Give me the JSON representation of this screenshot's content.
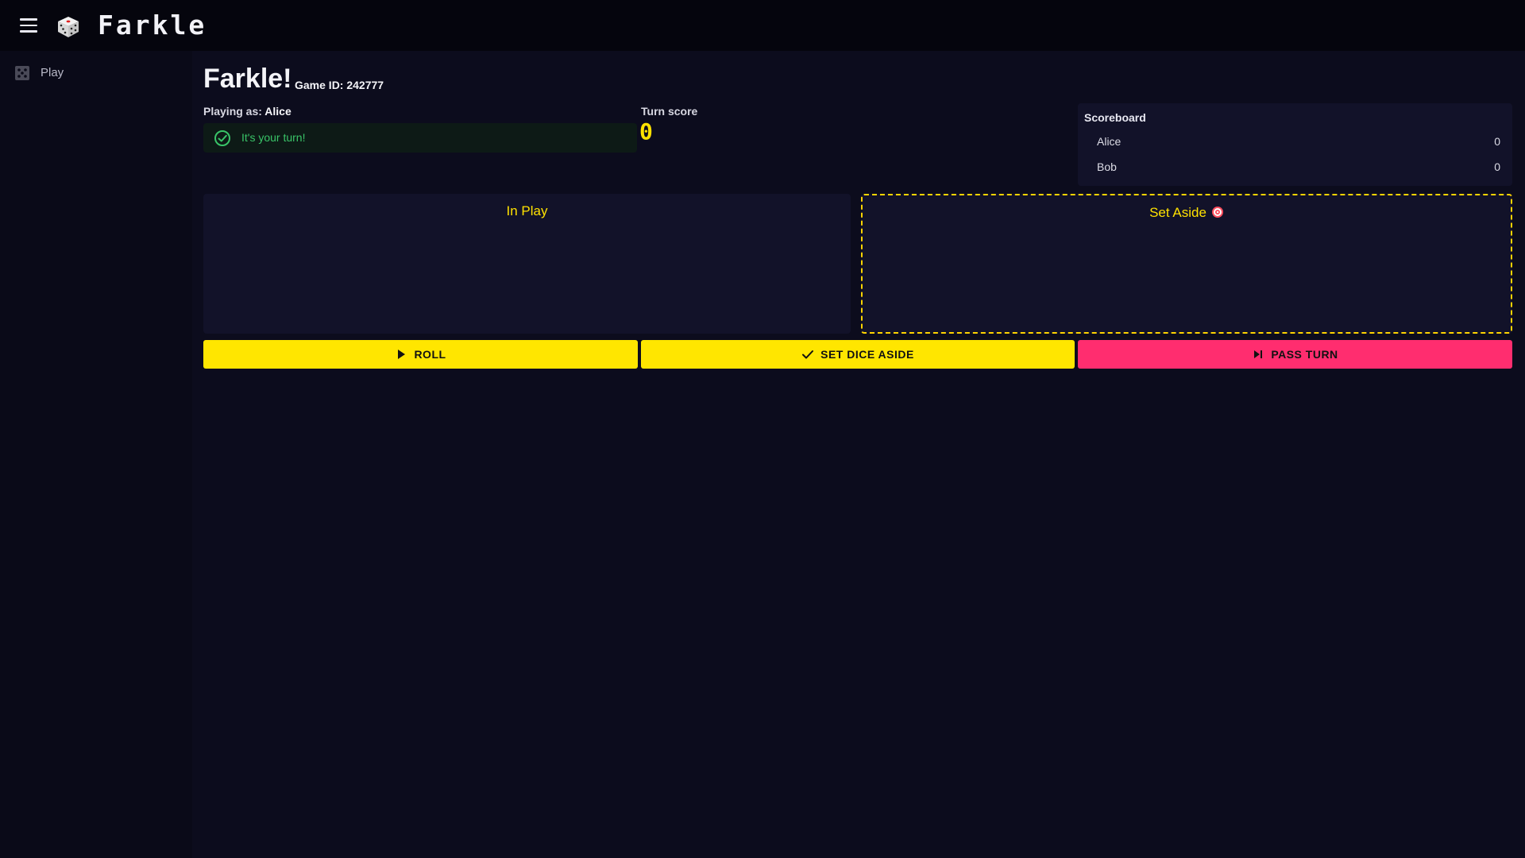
{
  "app": {
    "title": "Farkle"
  },
  "sidebar": {
    "items": [
      {
        "label": "Play"
      }
    ]
  },
  "game": {
    "title": "Farkle!",
    "game_id_label": "Game ID: 242777",
    "playing_as_label": "Playing as:",
    "player_name": "Alice",
    "status_message": "It's your turn!",
    "turn_score_label": "Turn score",
    "turn_score_value": "0"
  },
  "scoreboard": {
    "title": "Scoreboard",
    "rows": [
      {
        "name": "Alice",
        "score": "0"
      },
      {
        "name": "Bob",
        "score": "0"
      }
    ]
  },
  "zones": {
    "in_play": {
      "title": "In Play"
    },
    "set_aside": {
      "title": "Set Aside"
    }
  },
  "actions": {
    "roll": "ROLL",
    "set_dice_aside": "SET DICE ASIDE",
    "pass_turn": "PASS TURN"
  },
  "colors": {
    "background": "#0c0c1d",
    "accent_yellow": "#ffe600",
    "accent_pink": "#ff2d6f",
    "success_green": "#39c468"
  },
  "icons": {
    "menu": "hamburger-icon",
    "logo": "die-icon",
    "nav_play": "dice-grid-icon",
    "status": "check-circle-icon",
    "set_aside": "target-icon",
    "roll": "play-icon",
    "set_dice_aside": "checkmark-icon",
    "pass_turn": "skip-next-icon"
  }
}
